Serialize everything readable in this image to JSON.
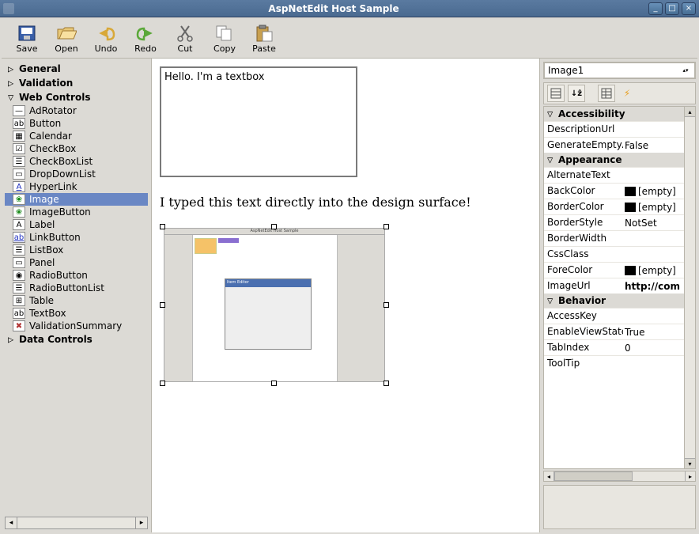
{
  "window": {
    "title": "AspNetEdit Host Sample"
  },
  "toolbar": {
    "save": "Save",
    "open": "Open",
    "undo": "Undo",
    "redo": "Redo",
    "cut": "Cut",
    "copy": "Copy",
    "paste": "Paste"
  },
  "toolbox": {
    "categories": {
      "general": "General",
      "validation": "Validation",
      "web": "Web Controls",
      "data": "Data Controls"
    },
    "web_items": [
      {
        "label": "AdRotator",
        "icon": "—"
      },
      {
        "label": "Button",
        "icon": "ab"
      },
      {
        "label": "Calendar",
        "icon": "▦"
      },
      {
        "label": "CheckBox",
        "icon": "☑"
      },
      {
        "label": "CheckBoxList",
        "icon": "☰"
      },
      {
        "label": "DropDownList",
        "icon": "▭"
      },
      {
        "label": "HyperLink",
        "icon": "A",
        "color": "#2030c0",
        "under": true
      },
      {
        "label": "Image",
        "icon": "❀",
        "color": "#1a8a1a",
        "selected": true
      },
      {
        "label": "ImageButton",
        "icon": "❀",
        "color": "#1a8a1a"
      },
      {
        "label": "Label",
        "icon": "A"
      },
      {
        "label": "LinkButton",
        "icon": "ab",
        "color": "#2030c0",
        "under": true
      },
      {
        "label": "ListBox",
        "icon": "☰"
      },
      {
        "label": "Panel",
        "icon": "▭"
      },
      {
        "label": "RadioButton",
        "icon": "◉"
      },
      {
        "label": "RadioButtonList",
        "icon": "☰"
      },
      {
        "label": "Table",
        "icon": "⊞"
      },
      {
        "label": "TextBox",
        "icon": "ab"
      },
      {
        "label": "ValidationSummary",
        "icon": "✖",
        "color": "#b03030"
      }
    ]
  },
  "design": {
    "textbox_text": "Hello. I'm a textbox",
    "typed_text": "I typed this text directly into the design surface!",
    "mock_dialog_title": "Item Editor",
    "mock_title": "AspNetEdit Host Sample"
  },
  "selector": {
    "value": "Image1"
  },
  "props": {
    "accessibility": {
      "title": "Accessibility",
      "rows": [
        {
          "name": "DescriptionUrl",
          "value": ""
        },
        {
          "name": "GenerateEmptyAlternateText",
          "value": "False"
        }
      ]
    },
    "appearance": {
      "title": "Appearance",
      "rows": [
        {
          "name": "AlternateText",
          "value": ""
        },
        {
          "name": "BackColor",
          "value": "[empty]",
          "swatch": true
        },
        {
          "name": "BorderColor",
          "value": "[empty]",
          "swatch": true
        },
        {
          "name": "BorderStyle",
          "value": "NotSet"
        },
        {
          "name": "BorderWidth",
          "value": ""
        },
        {
          "name": "CssClass",
          "value": ""
        },
        {
          "name": "ForeColor",
          "value": "[empty]",
          "swatch": true
        },
        {
          "name": "ImageUrl",
          "value": "http://com",
          "bold": true
        }
      ]
    },
    "behavior": {
      "title": "Behavior",
      "rows": [
        {
          "name": "AccessKey",
          "value": ""
        },
        {
          "name": "EnableViewState",
          "value": "True"
        },
        {
          "name": "TabIndex",
          "value": "0"
        },
        {
          "name": "ToolTip",
          "value": ""
        }
      ]
    }
  }
}
